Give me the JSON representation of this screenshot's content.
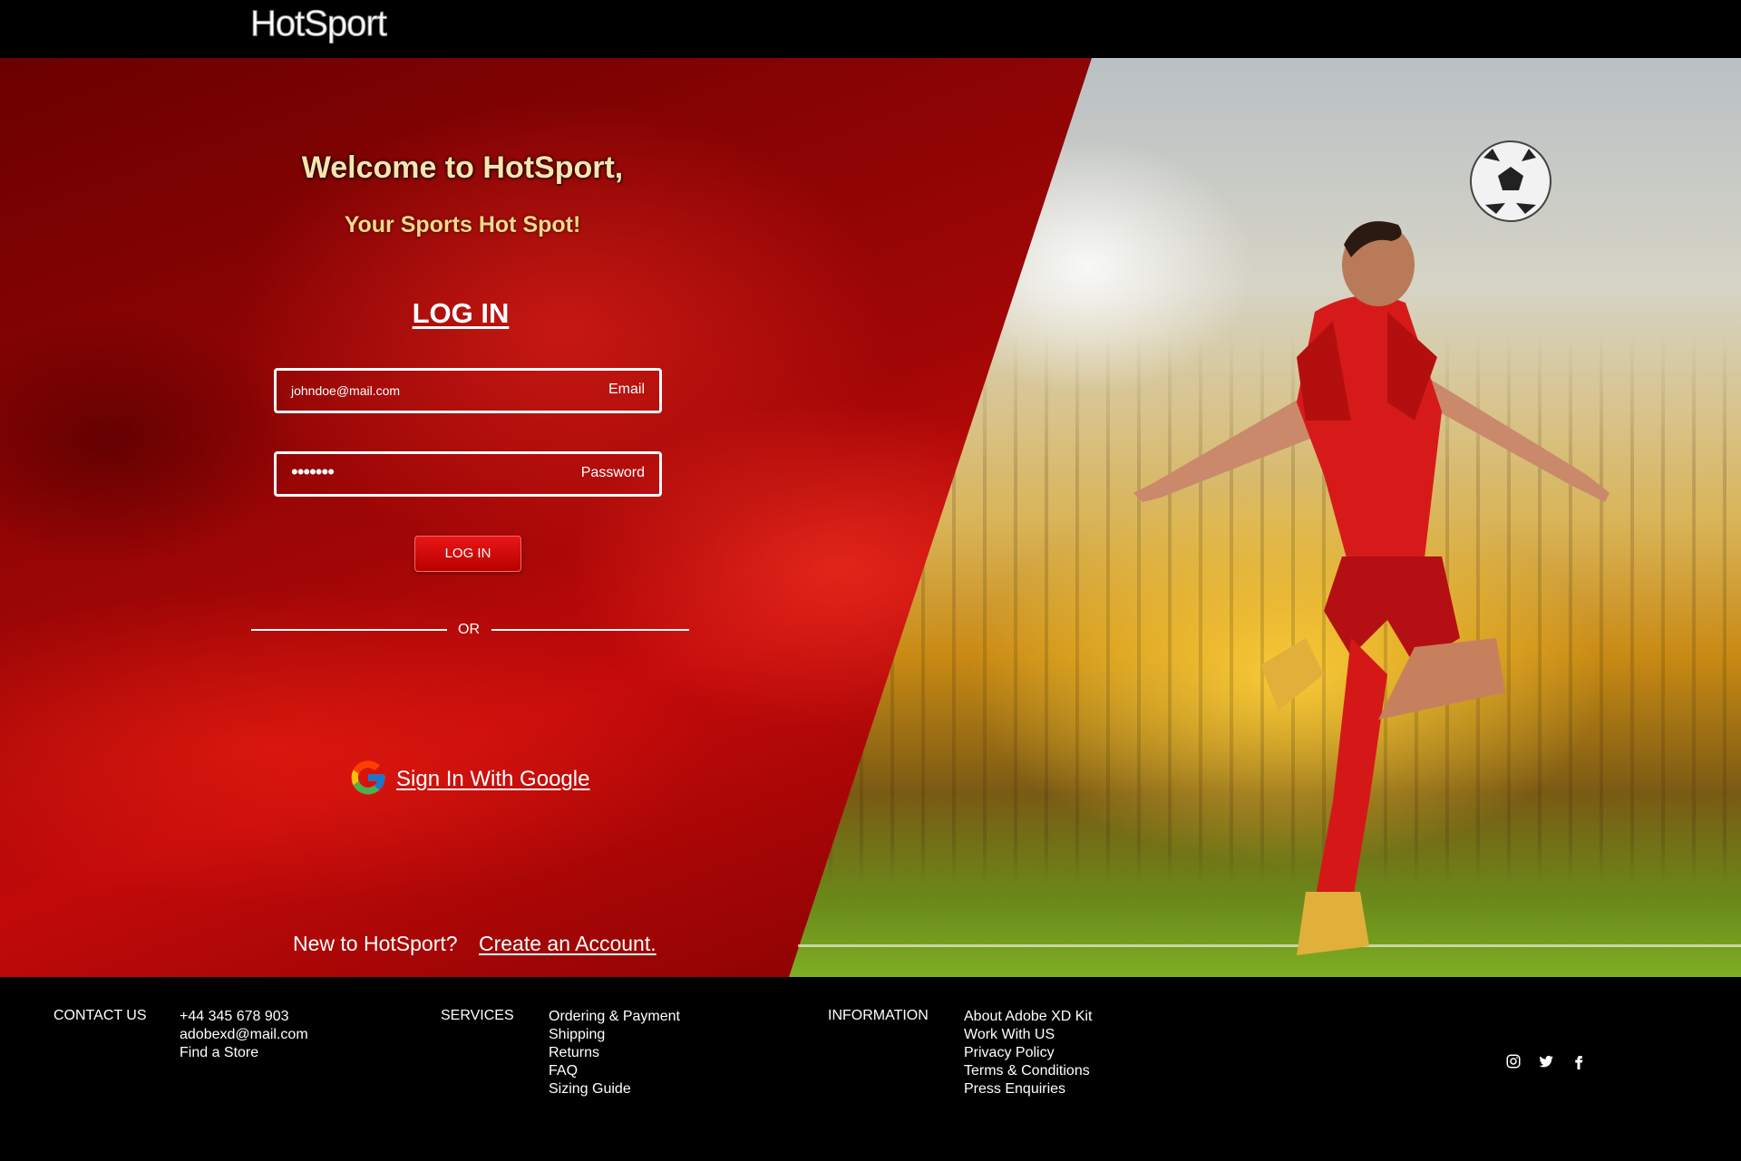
{
  "header": {
    "brand": "HotSport"
  },
  "hero": {
    "welcome": "Welcome to HotSport,",
    "tagline": "Your Sports Hot Spot!",
    "login_title": "LOG IN",
    "email": {
      "value": "johndoe@mail.com",
      "label": "Email"
    },
    "password": {
      "value": "•••••••",
      "label": "Password"
    },
    "login_button": "LOG IN",
    "or_text": "OR",
    "google_link": "Sign In With Google",
    "new_text": "New to HotSport?",
    "create_link": "Create an Account."
  },
  "footer": {
    "contact": {
      "heading": "CONTACT US",
      "items": [
        "+44 345 678 903",
        "adobexd@mail.com",
        "Find a Store"
      ]
    },
    "services": {
      "heading": "SERVICES",
      "items": [
        "Ordering & Payment",
        "Shipping",
        "Returns",
        "FAQ",
        "Sizing Guide"
      ]
    },
    "information": {
      "heading": "INFORMATION",
      "items": [
        "About Adobe XD Kit",
        "Work With US",
        "Privacy Policy",
        "Terms & Conditions",
        "Press Enquiries"
      ]
    },
    "socials": [
      "instagram-icon",
      "twitter-icon",
      "facebook-icon"
    ]
  },
  "colors": {
    "accent_red": "#d40000",
    "heading_gold": "#f7e4b0",
    "background": "#000000"
  }
}
